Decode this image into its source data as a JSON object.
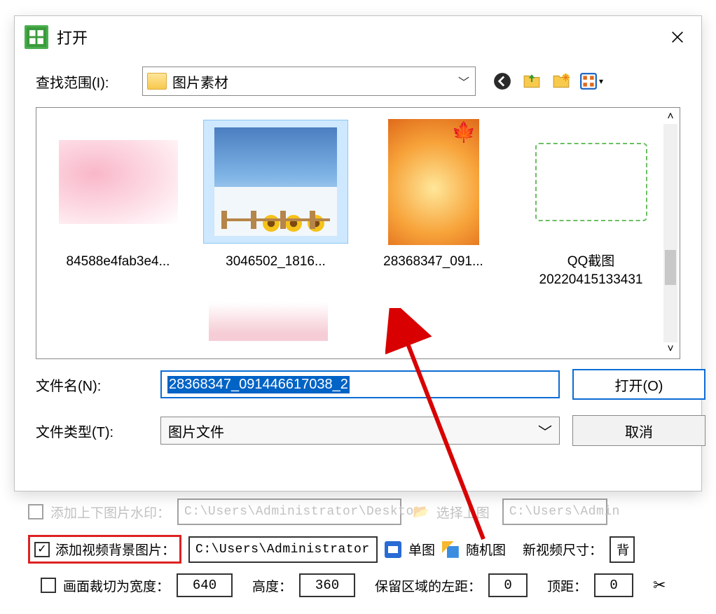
{
  "dialog": {
    "title": "打开",
    "look_in_label": "查找范围(I):",
    "look_in_value": "图片素材",
    "files": [
      {
        "name": "84588e4fab3e4..."
      },
      {
        "name": "3046502_1816..."
      },
      {
        "name": "28368347_091..."
      },
      {
        "name_line1": "QQ截图",
        "name_line2": "20220415133431"
      }
    ],
    "filename_label": "文件名(N):",
    "filename_value": "28368347_091446617038_2",
    "filetype_label": "文件类型(T):",
    "filetype_value": "图片文件",
    "open_btn": "打开(O)",
    "cancel_btn": "取消"
  },
  "parent": {
    "row1_label": "添加上下图片水印：",
    "row1_path": "C:\\Users\\Administrator\\Deskto",
    "row1_choose": "选择上图",
    "row1_path2": "C:\\Users\\Admin",
    "row2_label": "添加视频背景图片：",
    "row2_path": "C:\\Users\\Administrator",
    "row2_single": "单图",
    "row2_random": "随机图",
    "row2_size_label": "新视频尺寸：",
    "row2_size_value": "背",
    "row3_label": "画面裁切为宽度：",
    "row3_w": "640",
    "row3_h_label": "高度：",
    "row3_h": "360",
    "row3_left_label": "保留区域的左距：",
    "row3_left": "0",
    "row3_top_label": "顶距：",
    "row3_top": "0"
  }
}
